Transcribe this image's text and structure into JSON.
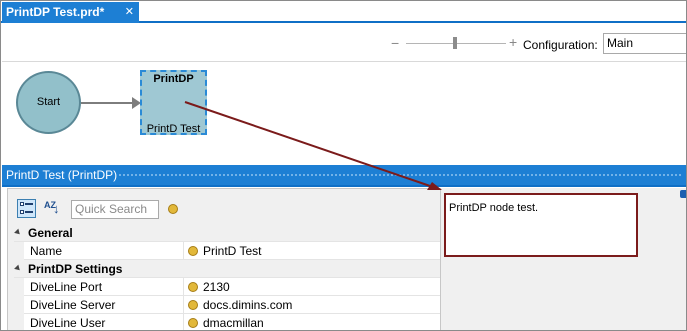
{
  "tab": {
    "title": "PrintDP Test.prd*",
    "close_glyph": "✕"
  },
  "toolbar": {
    "zoom_minus": "−",
    "zoom_plus": "+",
    "configuration_label": "Configuration:",
    "configuration_value": "Main"
  },
  "canvas": {
    "start_node": {
      "label": "Start"
    },
    "printdp_node": {
      "title": "PrintDP",
      "name": "PrintD Test"
    }
  },
  "property_panel": {
    "header": "PrintD Test (PrintDP)",
    "search_placeholder": "Quick Search",
    "sort_label": "AZ",
    "categories": [
      {
        "name": "General",
        "rows": [
          {
            "name": "Name",
            "value": "PrintD Test"
          }
        ]
      },
      {
        "name": "PrintDP Settings",
        "rows": [
          {
            "name": "DiveLine Port",
            "value": "2130"
          },
          {
            "name": "DiveLine Server",
            "value": "docs.dimins.com"
          },
          {
            "name": "DiveLine User",
            "value": "dmacmillan"
          }
        ]
      }
    ]
  },
  "note": {
    "text": "PrintDP node test."
  },
  "colors": {
    "accent_blue": "#1d7fd4",
    "annotation_red": "#7b1b1b",
    "node_fill": "#9fc8d3",
    "start_fill": "#92c0ca"
  }
}
